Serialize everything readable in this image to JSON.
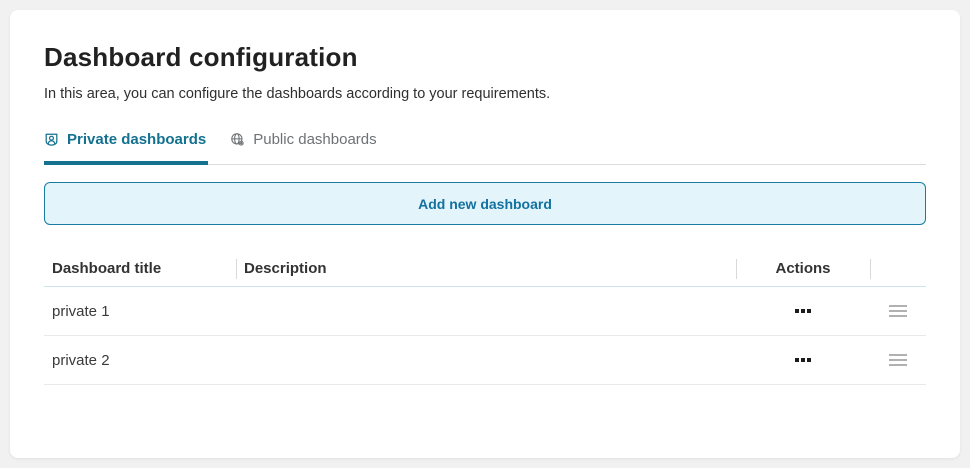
{
  "header": {
    "title": "Dashboard configuration",
    "subtitle": "In this area, you can configure the dashboards according to your requirements."
  },
  "tabs": [
    {
      "label": "Private dashboards",
      "icon": "user-shield-icon",
      "active": true
    },
    {
      "label": "Public dashboards",
      "icon": "globe-settings-icon",
      "active": false
    }
  ],
  "add_button": {
    "label": "Add new dashboard"
  },
  "table": {
    "columns": [
      "Dashboard title",
      "Description",
      "Actions",
      ""
    ],
    "rows": [
      {
        "title": "private 1",
        "description": "",
        "actions_icon": "ellipsis-icon",
        "drag_icon": "drag-handle-icon"
      },
      {
        "title": "private 2",
        "description": "",
        "actions_icon": "ellipsis-icon",
        "drag_icon": "drag-handle-icon"
      }
    ]
  },
  "colors": {
    "accent": "#14718f",
    "tab-inactive": "#6e7275",
    "button-bg": "#e3f4fa",
    "button-border": "#187ca1",
    "button-text": "#1271a1",
    "page-bg": "#f1f1f2",
    "card-bg": "#ffffff",
    "header-divider": "#cfe3ec",
    "row-divider": "#e9e9e9"
  }
}
